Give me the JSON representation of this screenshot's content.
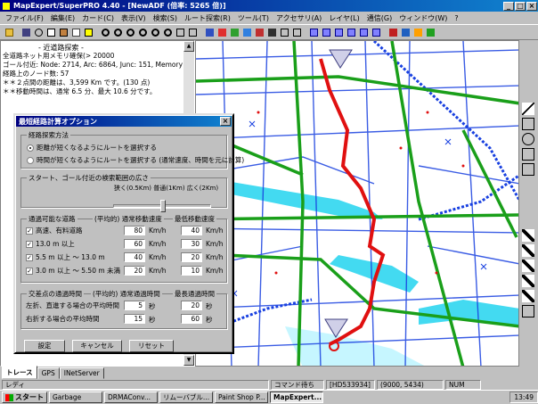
{
  "window": {
    "title": "MapExpert/SuperPRO 4.40 - [NewADF (倍率: 5265 倍)]",
    "buttons": [
      "_",
      "□",
      "×"
    ]
  },
  "menu": [
    "ファイル(F)",
    "編集(E)",
    "カード(C)",
    "表示(V)",
    "検索(S)",
    "ルート探索(R)",
    "ツール(T)",
    "アクセサリ(A)",
    "レイヤ(L)",
    "通信(G)",
    "ウィンドウ(W)",
    "?"
  ],
  "left_panel": {
    "header": "- 近道路探索 -",
    "lines": [
      "全道路ネット用メモリ確保(> 20000",
      "ゴール付近: Node: 2714, Arc: 6864, Junc: 151, Memory",
      "  経路上のノード数: 57",
      "  ＊＊２点間の距離は、3,599 Km です。(130 点)",
      "  ＊＊移動時間は、通常 6.5 分、最大 10.6 分です。"
    ]
  },
  "dialog": {
    "title": "最短経路計算オプション",
    "close": "×",
    "search_group": {
      "label": "経路探索方法",
      "options": [
        {
          "label": "距離が短くなるようにルートを選択する",
          "selected": true
        },
        {
          "label": "時間が短くなるようにルートを選択する (通常速度、時間を元に計算)",
          "selected": false
        }
      ]
    },
    "range_group": {
      "label": "スタート、ゴール付近の検索範囲の広さ",
      "scale": "狭く(0.5Km) 普通(1Km) 広く(2Km)",
      "slider_value": 0.5
    },
    "road_group": {
      "label": "通過可能な道路",
      "col_avg": "(平均的) 通常移動速度",
      "col_min": "最低移動速度",
      "rows": [
        {
          "label": "高速、有料道路",
          "checked": true,
          "normal": "80",
          "min": "40",
          "unit": "Km/h"
        },
        {
          "label": "13.0 m 以上",
          "checked": true,
          "normal": "60",
          "min": "30",
          "unit": "Km/h"
        },
        {
          "label": "5.5 m 以上 ～ 13.0 m",
          "checked": true,
          "normal": "40",
          "min": "20",
          "unit": "Km/h"
        },
        {
          "label": "3.0 m 以上 ～ 5.50 m 未満",
          "checked": true,
          "normal": "20",
          "min": "10",
          "unit": "Km/h"
        }
      ]
    },
    "junction_group": {
      "label": "交差点の通過時間",
      "col_avg": "(平均的) 通常通過時間",
      "col_max": "最長通過時間",
      "rows": [
        {
          "label": "左折、直進する場合の平均時間",
          "normal": "5",
          "max": "20",
          "unit": "秒"
        },
        {
          "label": "右折する場合の平均時間",
          "normal": "15",
          "max": "60",
          "unit": "秒"
        }
      ]
    },
    "buttons": {
      "ok": "設定",
      "cancel": "キャンセル",
      "reset": "リセット"
    }
  },
  "tabs": [
    "トレース",
    "GPS",
    "INetServer"
  ],
  "status": {
    "ready": "レディ",
    "mode": "コマンド待ち",
    "code": "[HD533934]",
    "coords": "(9000, 5434)",
    "num": "NUM"
  },
  "taskbar": {
    "start": "スタート",
    "tasks": [
      "Garbage",
      "DRMAConv...",
      "リムーバブル...",
      "Paint Shop P...",
      "MapExpert..."
    ],
    "active_task": 4,
    "clock": "13:49"
  },
  "colors": {
    "title": "#000080",
    "route": "#e01010",
    "road_main": "#1a9f1a",
    "road_blue": "#1040e0",
    "water": "#30d8f0"
  }
}
